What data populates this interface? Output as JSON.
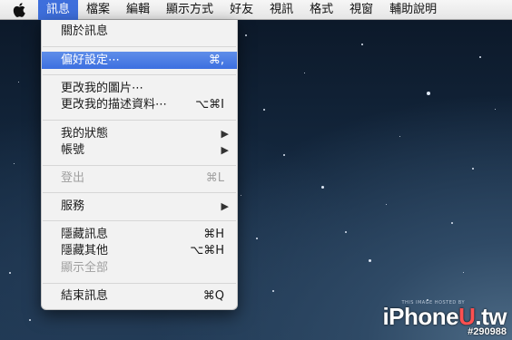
{
  "menubar": {
    "apple_icon": "apple-icon",
    "items": [
      {
        "label": "訊息"
      },
      {
        "label": "檔案"
      },
      {
        "label": "編輯"
      },
      {
        "label": "顯示方式"
      },
      {
        "label": "好友"
      },
      {
        "label": "視訊"
      },
      {
        "label": "格式"
      },
      {
        "label": "視窗"
      },
      {
        "label": "輔助說明"
      }
    ]
  },
  "menu": {
    "about": {
      "label": "關於訊息"
    },
    "preferences": {
      "label": "偏好設定⋯",
      "shortcut": "⌘,"
    },
    "change_picture": {
      "label": "更改我的圖片⋯"
    },
    "change_info": {
      "label": "更改我的描述資料⋯",
      "shortcut": "⌥⌘I"
    },
    "my_status": {
      "label": "我的狀態"
    },
    "accounts": {
      "label": "帳號"
    },
    "logout": {
      "label": "登出",
      "shortcut": "⌘L"
    },
    "services": {
      "label": "服務"
    },
    "hide": {
      "label": "隱藏訊息",
      "shortcut": "⌘H"
    },
    "hide_others": {
      "label": "隱藏其他",
      "shortcut": "⌥⌘H"
    },
    "show_all": {
      "label": "顯示全部"
    },
    "quit": {
      "label": "結束訊息",
      "shortcut": "⌘Q"
    }
  },
  "watermark": {
    "small": "THIS IMAGE HOSTED BY",
    "logo_pre": "iPhone",
    "logo_u": "U",
    "logo_post": ".tw",
    "id": "#290988"
  },
  "colors": {
    "highlight": "#3e6fdc",
    "menu_bg": "#f2f2f2"
  }
}
